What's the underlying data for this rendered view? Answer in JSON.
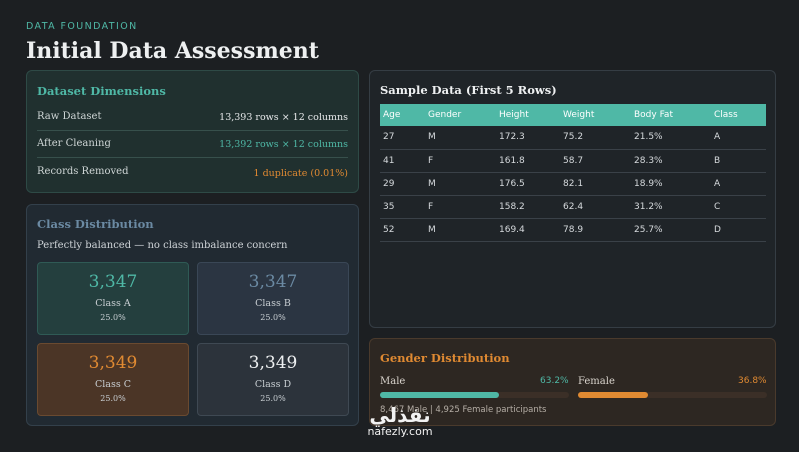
{
  "header": {
    "eyebrow": "DATA FOUNDATION",
    "title": "Initial Data Assessment"
  },
  "dimensions": {
    "title": "Dataset Dimensions",
    "rows": [
      {
        "label": "Raw Dataset",
        "value": "13,393 rows × 12 columns",
        "color": "#e6e8ea"
      },
      {
        "label": "After Cleaning",
        "value": "13,392 rows × 12 columns",
        "color": "#4fb8a6"
      },
      {
        "label": "Records Removed",
        "value": "1 duplicate (0.01%)",
        "color": "#e08a32"
      }
    ]
  },
  "class_distribution": {
    "title": "Class Distribution",
    "subtitle": "Perfectly balanced — no class imbalance concern",
    "tiles": [
      {
        "count": "3,347",
        "label": "Class A",
        "pct": "25.0%",
        "color": "#4fb8a6"
      },
      {
        "count": "3,347",
        "label": "Class B",
        "pct": "25.0%",
        "color": "#6b8aa3"
      },
      {
        "count": "3,349",
        "label": "Class C",
        "pct": "25.0%",
        "color": "#e08a32"
      },
      {
        "count": "3,349",
        "label": "Class D",
        "pct": "25.0%",
        "color": "#eef0f1"
      }
    ]
  },
  "sample": {
    "title": "Sample Data (First 5 Rows)",
    "columns": [
      "Age",
      "Gender",
      "Height",
      "Weight",
      "Body Fat",
      "Class"
    ],
    "rows": [
      [
        "27",
        "M",
        "172.3",
        "75.2",
        "21.5%",
        "A"
      ],
      [
        "41",
        "F",
        "161.8",
        "58.7",
        "28.3%",
        "B"
      ],
      [
        "29",
        "M",
        "176.5",
        "82.1",
        "18.9%",
        "A"
      ],
      [
        "35",
        "F",
        "158.2",
        "62.4",
        "31.2%",
        "C"
      ],
      [
        "52",
        "M",
        "169.4",
        "78.9",
        "25.7%",
        "D"
      ]
    ]
  },
  "gender": {
    "title": "Gender Distribution",
    "male_label": "Male",
    "male_pct": "63.2%",
    "male_fraction": 0.632,
    "male_color": "#4fb8a6",
    "female_label": "Female",
    "female_pct": "36.8%",
    "female_fraction": 0.368,
    "female_color": "#e08a32",
    "note": "8,467 Male | 4,925 Female participants"
  },
  "watermark": {
    "mark": "نفذلي",
    "url": "nafezly.com"
  }
}
